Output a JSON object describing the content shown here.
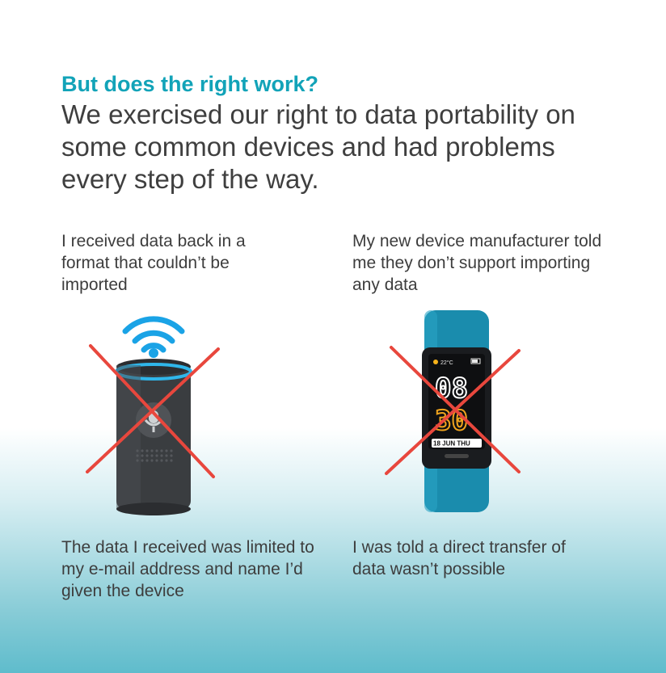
{
  "heading": {
    "title": "But does the right work?",
    "subtitle": "We exercised our right to data portability on some common devices and had problems every step of the way."
  },
  "left": {
    "top_caption": "I received data back in a format that couldn’t be imported",
    "bottom_caption": "The data I received was limited to my e-mail address and name I’d given the device",
    "image_icon": "smart-speaker-icon"
  },
  "right": {
    "top_caption": "My new device manufacturer told me they don’t support importing any data",
    "bottom_caption": "I was told a direct transfer of data wasn’t possible",
    "image_icon": "fitness-band-icon",
    "screen": {
      "temperature": "22°C",
      "time_top": "08",
      "time_bottom": "30",
      "date": "18 JUN THU"
    }
  },
  "colors": {
    "accent": "#12a3b8",
    "cross": "#e8473d",
    "band": "#1a8cad",
    "speaker": "#3a3d40",
    "wifi": "#1aa3e6"
  }
}
